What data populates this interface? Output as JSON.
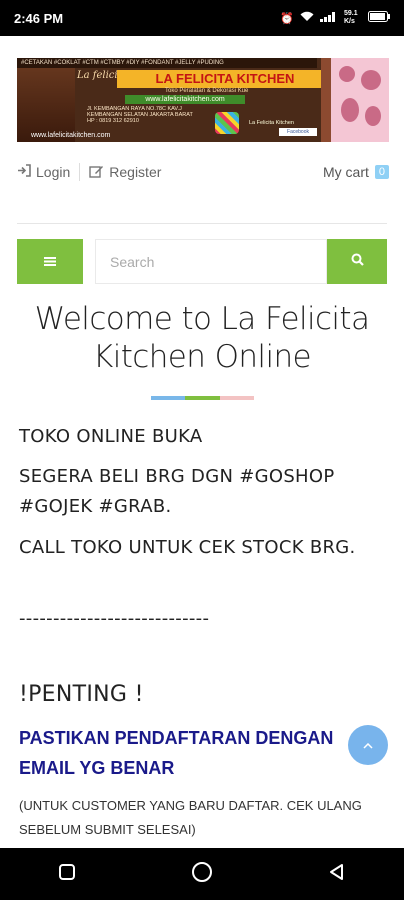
{
  "status_bar": {
    "time": "2:46 PM",
    "net": "59.1 K/s"
  },
  "banner": {
    "top_line": "#CETAKAN #COKLAT #CTM #CTMBY #DIY #FONDANT #JELLY #PUDING",
    "brand_script": "La felicita",
    "brand": "LA FELICITA KITCHEN",
    "tagline": "Toko Peralatan & Dekorasi Kue",
    "website": "www.lafelicitakitchen.com",
    "address": "Jl. KEMBANGAN RAYA NO.78C KAV.J KEMBANGAN SELATAN JAKARTA BARAT HP : 0819 312 62910",
    "website_lower": "www.lafelicitakitchen.com",
    "right_label": "La Felicita Kitchen",
    "facebook": "Facebook"
  },
  "auth": {
    "login": "Login",
    "register": "Register",
    "cart_label": "My cart",
    "cart_count": "0"
  },
  "search": {
    "placeholder": "Search"
  },
  "welcome": {
    "title": "Welcome to La Felicita Kitchen Online"
  },
  "content": {
    "line1": "TOKO ONLINE BUKA",
    "line2": "SEGERA BELI BRG DGN #GOSHOP #GOJEK #GRAB.",
    "line3": "CALL TOKO UNTUK CEK STOCK BRG.",
    "line4": "----------------------------",
    "line5": "!PENTING !",
    "important": "PASTIKAN PENDAFTARAN DENGAN EMAIL YG BENAR",
    "note": "(UNTUK CUSTOMER YANG BARU DAFTAR. CEK ULANG SEBELUM SUBMIT SELESAI)"
  },
  "colors": {
    "green": "#7fbf3f",
    "bar_blue": "#79b7e9",
    "bar_green": "#7fbf3f",
    "bar_pink": "#f3c3c3",
    "important": "#1a1a8a",
    "fab": "#78b4ec"
  },
  "icons": {
    "menu": "hamburger-icon",
    "search": "magnifier-icon",
    "login": "sign-in-icon",
    "register": "edit-icon",
    "fab": "chevron-up-icon"
  }
}
